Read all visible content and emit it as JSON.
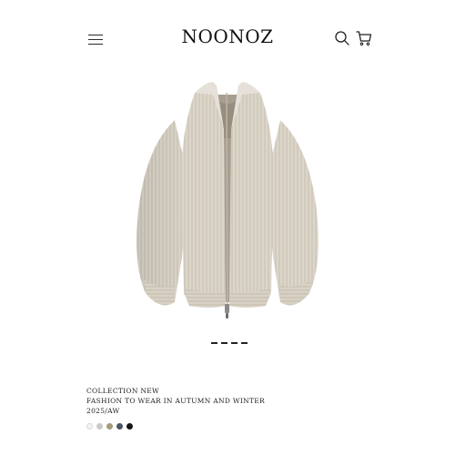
{
  "header": {
    "brand": "NOONOZ",
    "menu_icon": "hamburger-menu-icon",
    "search_icon": "search-icon",
    "cart_icon": "shopping-cart-icon"
  },
  "product": {
    "image_alt": "zip-up knit cardigan",
    "collection_line": "COLLECTION NEW",
    "tagline": "FASHION TO WEAR IN AUTUMN AND WINTER",
    "season": "2025/AW"
  },
  "gallery": {
    "slides": 4,
    "active": 1
  },
  "swatches": [
    {
      "name": "white",
      "color": "#f1f1f1"
    },
    {
      "name": "light-grey",
      "color": "#c9c9c9"
    },
    {
      "name": "khaki",
      "color": "#a49a7c"
    },
    {
      "name": "slate",
      "color": "#4a5563"
    },
    {
      "name": "black",
      "color": "#151515"
    }
  ],
  "colors": {
    "knit_base": "#dcd6ca",
    "knit_shadow": "#bfb7a8",
    "knit_highlight": "#ebe7df",
    "lining": "#a79e90"
  }
}
